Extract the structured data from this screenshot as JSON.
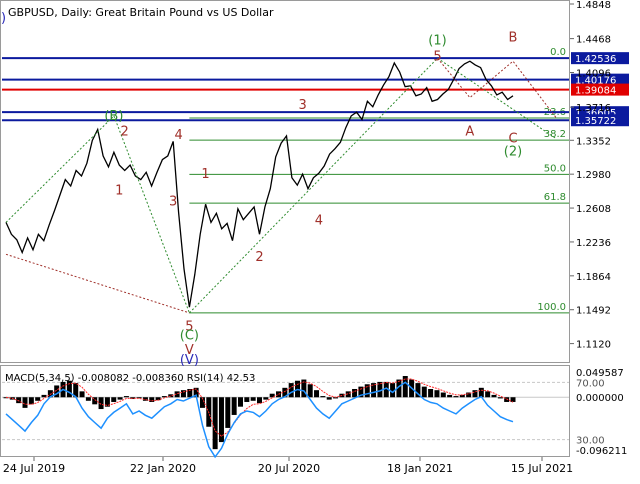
{
  "header": {
    "symbol_line": "GBPUSD, Daily:  Great Britain Pound vs US Dollar",
    "corner_mark": ")"
  },
  "colors": {
    "price": "#000000",
    "wave_green": "#2e8b2e",
    "wave_red": "#a0302a",
    "wave_blue": "#2a2ab8",
    "support_blue": "#0b1a9e",
    "resistance_red": "#e00000",
    "grid": "#c8c8c8",
    "macd_hist": "#000000",
    "rsi_line": "#1e90ff",
    "macd_signal": "#ff2a2a"
  },
  "chart_data": [
    {
      "type": "line",
      "title": "GBPUSD, Daily: Great Britain Pound vs US Dollar",
      "x_ticks": [
        "24 Jul 2019",
        "22 Jan 2020",
        "20 Jul 2020",
        "18 Jan 2021",
        "15 Jul 2021"
      ],
      "y_ticks": [
        1.4848,
        1.4468,
        1.4096,
        1.3716,
        1.3352,
        1.298,
        1.2608,
        1.2236,
        1.1864,
        1.1492,
        1.112
      ],
      "ylim": [
        1.094,
        1.487
      ],
      "series": [
        {
          "values": [
            1.245,
            1.232,
            1.226,
            1.212,
            1.228,
            1.215,
            1.232,
            1.225,
            1.242,
            1.258,
            1.275,
            1.292,
            1.285,
            1.302,
            1.296,
            1.31,
            1.335,
            1.347,
            1.318,
            1.306,
            1.322,
            1.308,
            1.302,
            1.308,
            1.296,
            1.292,
            1.3,
            1.285,
            1.3,
            1.314,
            1.318,
            1.334,
            1.256,
            1.194,
            1.152,
            1.188,
            1.232,
            1.265,
            1.245,
            1.255,
            1.238,
            1.244,
            1.225,
            1.26,
            1.248,
            1.255,
            1.262,
            1.232,
            1.262,
            1.282,
            1.317,
            1.332,
            1.34,
            1.294,
            1.286,
            1.298,
            1.282,
            1.294,
            1.299,
            1.307,
            1.32,
            1.326,
            1.333,
            1.349,
            1.362,
            1.366,
            1.358,
            1.378,
            1.372,
            1.385,
            1.396,
            1.405,
            1.42,
            1.41,
            1.394,
            1.395,
            1.384,
            1.386,
            1.393,
            1.378,
            1.38,
            1.386,
            1.391,
            1.402,
            1.414,
            1.419,
            1.422,
            1.418,
            1.415,
            1.402,
            1.395,
            1.385,
            1.388,
            1.38,
            1.384
          ],
          "color": "#000000"
        }
      ],
      "horizontal_levels": [
        {
          "value": 1.42536,
          "label": "1.42536",
          "color": "#0b1a9e"
        },
        {
          "value": 1.40176,
          "label": "1.40176",
          "color": "#0b1a9e"
        },
        {
          "value": 1.39084,
          "label": "1.39084",
          "color": "#e00000"
        },
        {
          "value": 1.36605,
          "label": "1.36605",
          "color": "#0b1a9e"
        },
        {
          "value": 1.35722,
          "label": "1.35722",
          "color": "#0b1a9e"
        }
      ],
      "fibonacci": [
        {
          "label": "0.0",
          "value": 1.4253
        },
        {
          "label": "23.6",
          "value": 1.3597
        },
        {
          "label": "38.2",
          "value": 1.3354
        },
        {
          "label": "50.0",
          "value": 1.2978
        },
        {
          "label": "61.8",
          "value": 1.2662
        },
        {
          "label": "100.0",
          "value": 1.1457
        }
      ],
      "wave_labels": [
        {
          "text": "(B)",
          "index": 20,
          "value": 1.362,
          "color": "#2e8b2e",
          "circled": true
        },
        {
          "text": "2",
          "index": 22,
          "value": 1.345,
          "color": "#a0302a"
        },
        {
          "text": "1",
          "index": 21,
          "value": 1.28,
          "color": "#a0302a"
        },
        {
          "text": "4",
          "index": 32,
          "value": 1.341,
          "color": "#a0302a"
        },
        {
          "text": "3",
          "index": 31,
          "value": 1.268,
          "color": "#a0302a"
        },
        {
          "text": "1",
          "index": 37,
          "value": 1.298,
          "color": "#a0302a"
        },
        {
          "text": "2",
          "index": 47,
          "value": 1.207,
          "color": "#a0302a"
        },
        {
          "text": "3",
          "index": 55,
          "value": 1.374,
          "color": "#a0302a"
        },
        {
          "text": "4",
          "index": 58,
          "value": 1.247,
          "color": "#a0302a"
        },
        {
          "text": "5",
          "index": 80,
          "value": 1.427,
          "color": "#a0302a"
        },
        {
          "text": "(1)",
          "index": 80,
          "value": 1.445,
          "color": "#2e8b2e",
          "circled": true
        },
        {
          "text": "A",
          "index": 86,
          "value": 1.345,
          "color": "#a0302a"
        },
        {
          "text": "B",
          "index": 94,
          "value": 1.448,
          "color": "#a0302a"
        },
        {
          "text": "C",
          "index": 102,
          "value": 1.337,
          "color": "#a0302a"
        },
        {
          "text": "(2)",
          "index": 102,
          "value": 1.323,
          "color": "#2e8b2e",
          "circled": true
        },
        {
          "text": "5",
          "index": 34,
          "value": 1.131,
          "color": "#a0302a"
        },
        {
          "text": "(C)",
          "index": 34,
          "value": 1.121,
          "color": "#2e8b2e",
          "circled": true
        },
        {
          "text": "V",
          "index": 34,
          "value": 1.105,
          "color": "#a0302a"
        },
        {
          "text": "(V)",
          "index": 34,
          "value": 1.094,
          "color": "#2a2ab8",
          "circled": true
        }
      ]
    },
    {
      "type": "line",
      "title": "MACD(5,34,5) -0.008082 -0.008360 RSI(14) 42.53",
      "y_ticks_left": [
        "0.049587",
        "0.000000",
        "-0.096211"
      ],
      "rsi_ticks": [
        "70.00",
        "30.00"
      ],
      "macd_range": [
        -0.096211,
        0.049587
      ],
      "rsi_range": [
        20,
        80
      ],
      "macd_hist": [
        0.0,
        -0.004,
        -0.01,
        -0.018,
        -0.012,
        -0.006,
        0.004,
        0.012,
        0.02,
        0.026,
        0.028,
        0.024,
        0.01,
        -0.006,
        -0.012,
        -0.02,
        -0.016,
        -0.008,
        -0.004,
        0.002,
        -0.003,
        -0.001,
        -0.006,
        -0.008,
        -0.005,
        0.002,
        0.005,
        0.01,
        0.012,
        0.014,
        0.016,
        -0.018,
        -0.05,
        -0.088,
        -0.076,
        -0.052,
        -0.03,
        -0.016,
        -0.008,
        -0.006,
        -0.01,
        -0.004,
        0.006,
        0.01,
        0.016,
        0.024,
        0.028,
        0.03,
        0.022,
        0.012,
        0.002,
        -0.004,
        -0.002,
        0.006,
        0.01,
        0.014,
        0.018,
        0.022,
        0.024,
        0.026,
        0.026,
        0.024,
        0.03,
        0.036,
        0.03,
        0.024,
        0.018,
        0.014,
        0.012,
        0.008,
        0.004,
        0.002,
        0.004,
        0.008,
        0.012,
        0.016,
        0.01,
        0.004,
        -0.002,
        -0.008,
        -0.008
      ],
      "macd_signal": [
        0.0,
        -0.002,
        -0.006,
        -0.012,
        -0.012,
        -0.009,
        -0.002,
        0.005,
        0.012,
        0.019,
        0.023,
        0.024,
        0.017,
        0.005,
        -0.004,
        -0.012,
        -0.014,
        -0.011,
        -0.007,
        -0.002,
        -0.002,
        -0.002,
        -0.004,
        -0.006,
        -0.005,
        -0.001,
        0.002,
        0.006,
        0.009,
        0.012,
        0.014,
        -0.002,
        -0.026,
        -0.057,
        -0.066,
        -0.059,
        -0.044,
        -0.03,
        -0.019,
        -0.012,
        -0.011,
        -0.007,
        -0.001,
        0.005,
        0.01,
        0.017,
        0.022,
        0.026,
        0.024,
        0.018,
        0.01,
        0.003,
        0.0,
        0.003,
        0.006,
        0.01,
        0.014,
        0.018,
        0.021,
        0.023,
        0.025,
        0.024,
        0.027,
        0.031,
        0.031,
        0.027,
        0.022,
        0.018,
        0.015,
        0.011,
        0.007,
        0.004,
        0.004,
        0.006,
        0.009,
        0.012,
        0.011,
        0.007,
        0.002,
        -0.003,
        -0.00836
      ],
      "rsi": [
        48,
        44,
        40,
        36,
        42,
        47,
        55,
        60,
        62,
        65,
        63,
        60,
        52,
        46,
        42,
        38,
        45,
        49,
        52,
        55,
        48,
        50,
        47,
        45,
        49,
        53,
        55,
        58,
        57,
        59,
        61,
        40,
        25,
        18,
        24,
        34,
        42,
        48,
        50,
        49,
        46,
        50,
        55,
        58,
        60,
        63,
        65,
        64,
        58,
        52,
        48,
        45,
        50,
        55,
        57,
        59,
        61,
        62,
        63,
        64,
        66,
        63,
        67,
        70,
        66,
        62,
        58,
        56,
        55,
        52,
        50,
        48,
        52,
        55,
        58,
        60,
        54,
        50,
        46,
        44,
        42.53
      ]
    }
  ]
}
